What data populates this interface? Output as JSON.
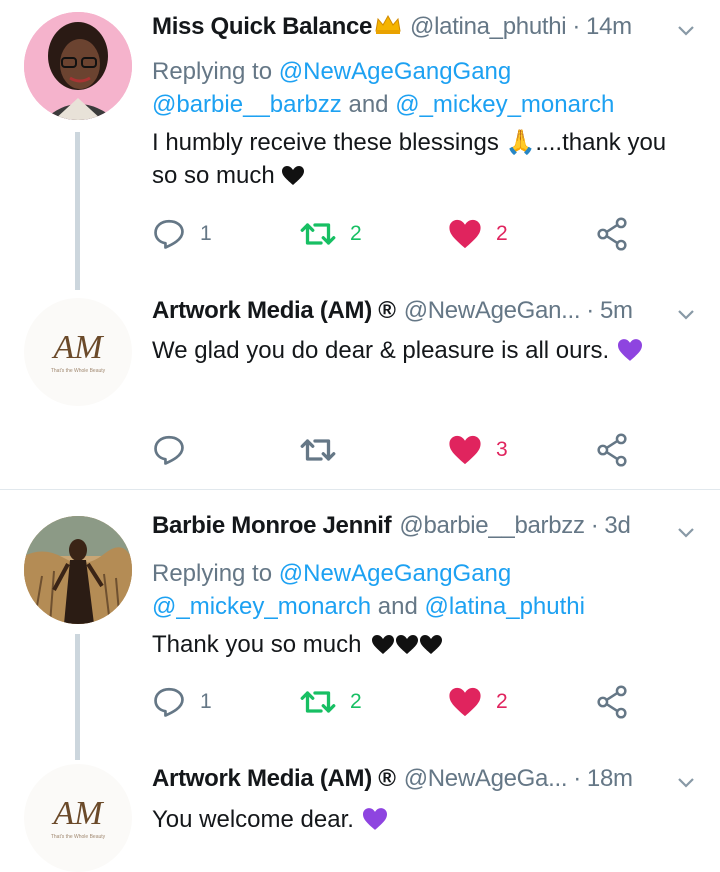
{
  "tweets": [
    {
      "name": "Miss Quick Balance",
      "handle": "@latina_phuthi",
      "separator": "·",
      "time": "14m",
      "reply_prefix": "Replying to",
      "reply_users": [
        "@NewAgeGangGang",
        "@barbie__barbzz",
        "@_mickey_monarch"
      ],
      "reply_and": "and",
      "text_before": "I humbly receive these blessings",
      "text_emoji": "🙏",
      "text_after": "....thank you so so much",
      "replies": "1",
      "retweets": "2",
      "likes": "2",
      "liked": true
    },
    {
      "name": "Artwork Media (AM) ®",
      "handle": "@NewAgeGan...",
      "separator": "·",
      "time": "5m",
      "text": "We glad you do dear & pleasure is all ours.",
      "avatar_text": "AM",
      "avatar_tagline": "That's the Whole Beauty",
      "replies": "",
      "retweets": "",
      "likes": "3",
      "liked": true
    },
    {
      "name": "Barbie Monroe Jennif",
      "handle": "@barbie__barbzz",
      "separator": "·",
      "time": "3d",
      "reply_prefix": "Replying to",
      "reply_users": [
        "@NewAgeGangGang",
        "@_mickey_monarch",
        "@latina_phuthi"
      ],
      "reply_and": "and",
      "text": "Thank you so much",
      "replies": "1",
      "retweets": "2",
      "likes": "2",
      "liked": true
    },
    {
      "name": "Artwork Media (AM) ®",
      "handle": "@NewAgeGa...",
      "separator": "·",
      "time": "18m",
      "text": "You welcome dear.",
      "avatar_text": "AM",
      "avatar_tagline": "That's the Whole Beauty"
    }
  ],
  "colors": {
    "link": "#1da1f2",
    "secondary": "#657786",
    "retweet": "#17bf63",
    "like": "#e0245e",
    "purple_heart": "#8e44e0"
  },
  "icons": [
    "reply-icon",
    "retweet-icon",
    "like-icon",
    "share-icon",
    "chevron-down-icon",
    "crown-icon",
    "black-heart-icon",
    "purple-heart-icon"
  ]
}
